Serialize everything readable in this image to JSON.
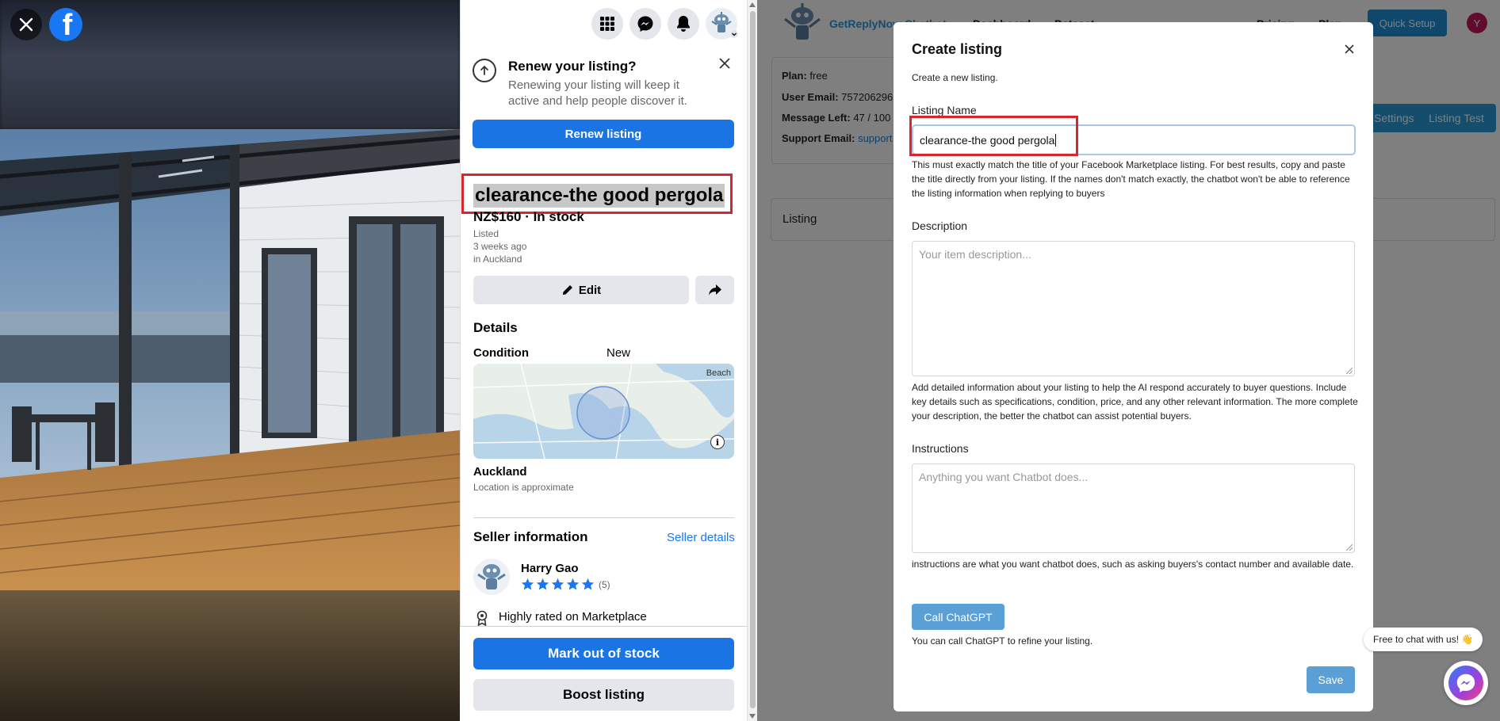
{
  "facebook": {
    "renew": {
      "title": "Renew your listing?",
      "text": "Renewing your listing will keep it active and help people discover it.",
      "button": "Renew listing"
    },
    "listing": {
      "title": "clearance-the good pergola",
      "price_line": "NZ$160 · In stock",
      "listed_label": "Listed",
      "listed_when": "3 weeks ago",
      "listed_where": "in Auckland"
    },
    "actions": {
      "edit": "Edit"
    },
    "details": {
      "heading": "Details",
      "condition_label": "Condition",
      "condition_value": "New",
      "map_place_label": "Beach",
      "location_name": "Auckland",
      "location_note": "Location is approximate"
    },
    "seller": {
      "heading": "Seller information",
      "details_link": "Seller details",
      "name": "Harry Gao",
      "rating_count": "(5)",
      "rating_stars": 5,
      "badge": "Highly rated on Marketplace"
    },
    "bottom": {
      "mark_out": "Mark out of stock",
      "boost": "Boost listing"
    },
    "colors": {
      "primary": "#1b74e4",
      "link": "#1877f2",
      "highlight": "#d9262c"
    }
  },
  "app": {
    "brand": "GetReplyNow Chatbot",
    "nav": [
      "Dashboard",
      "Dataset",
      "Pricing",
      "Plan"
    ],
    "quick_setup": "Quick Setup",
    "user_initial": "Y",
    "info": {
      "plan_label": "Plan:",
      "plan_value": "free",
      "email_label": "User Email:",
      "email_value": "757206296",
      "msg_label": "Message Left:",
      "msg_value": "47 / 100",
      "support_label": "Support Email:",
      "support_value": "support"
    },
    "btn_settings": "Settings",
    "btn_listing_test": "Listing Test",
    "listing_strip": "Listing"
  },
  "modal": {
    "title": "Create listing",
    "subtitle": "Create a new listing.",
    "name_label": "Listing Name",
    "name_value": "clearance-the good pergola",
    "name_help": "This must exactly match the title of your Facebook Marketplace listing. For best results, copy and paste the title directly from your listing. If the names don't match exactly, the chatbot won't be able to reference the listing information when replying to buyers",
    "desc_label": "Description",
    "desc_placeholder": "Your item description...",
    "desc_help": "Add detailed information about your listing to help the AI respond accurately to buyer questions. Include key details such as specifications, condition, price, and any other relevant information. The more complete your description, the better the chatbot can assist potential buyers.",
    "instr_label": "Instructions",
    "instr_placeholder": "Anything you want Chatbot does...",
    "instr_help": "instructions are what you want chatbot does, such as asking buyers's contact number and available date.",
    "gpt_button": "Call ChatGPT",
    "gpt_help": "You can call ChatGPT to refine your listing.",
    "save": "Save"
  },
  "chat_widget": {
    "bubble": "Free to chat with us! 👋"
  }
}
